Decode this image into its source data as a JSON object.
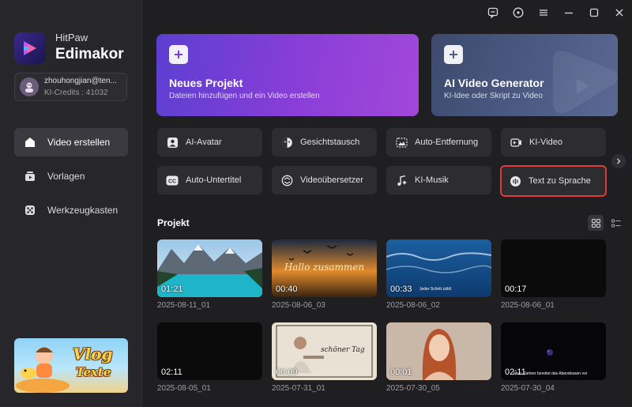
{
  "sidebar": {
    "brand": "HitPaw",
    "product": "Edimakor",
    "account": {
      "email": "zhouhongjian@ten...",
      "credits": "KI-Credits : 41032"
    },
    "nav": [
      {
        "label": "Video erstellen",
        "icon": "home-icon",
        "active": true
      },
      {
        "label": "Vorlagen",
        "icon": "templates-icon",
        "active": false
      },
      {
        "label": "Werkzeugkasten",
        "icon": "toolbox-icon",
        "active": false
      }
    ],
    "promo": {
      "line1": "Vlog",
      "line2": "Texte"
    }
  },
  "cards": {
    "new_project": {
      "title": "Neues Projekt",
      "subtitle": "Dateien hinzufügen und ein Video erstellen"
    },
    "ai_generator": {
      "title": "AI Video Generator",
      "subtitle": "KI-Idee oder Skript zu Video"
    }
  },
  "tools": [
    {
      "label": "AI-Avatar",
      "icon": "avatar-icon"
    },
    {
      "label": "Gesichtstausch",
      "icon": "face-swap-icon"
    },
    {
      "label": "Auto-Entfernung",
      "icon": "auto-remove-icon"
    },
    {
      "label": "KI-Video",
      "icon": "ai-video-icon"
    },
    {
      "label": "Auto-Untertitel",
      "icon": "subtitle-icon"
    },
    {
      "label": "Videoübersetzer",
      "icon": "translate-icon"
    },
    {
      "label": "KI-Musik",
      "icon": "music-icon"
    },
    {
      "label": "Text zu Sprache",
      "icon": "text-to-speech-icon",
      "highlighted": true
    }
  ],
  "projects": {
    "title": "Projekt",
    "items": [
      {
        "duration": "01:21",
        "name": "2025-08-11_01",
        "caption": ""
      },
      {
        "duration": "00:40",
        "name": "2025-08-06_03",
        "caption": "Hallo zusammen"
      },
      {
        "duration": "00:33",
        "name": "2025-08-06_02",
        "caption": "Jeder Schritt zählt"
      },
      {
        "duration": "00:17",
        "name": "2025-08-06_01",
        "caption": ""
      },
      {
        "duration": "02:11",
        "name": "2025-08-05_01",
        "caption": ""
      },
      {
        "duration": "00:09",
        "name": "2025-07-31_01",
        "caption": "schöner Tag"
      },
      {
        "duration": "00:01",
        "name": "2025-07-30_05",
        "caption": ""
      },
      {
        "duration": "02:11",
        "name": "2025-07-30_04",
        "caption": "Mein Partner bereitet das Abendessen vor"
      }
    ]
  },
  "colors": {
    "accent_purple": "#8a3ed8",
    "highlight_red": "#e03b3b",
    "background": "#1f1f22",
    "sidebar": "#27272b"
  }
}
